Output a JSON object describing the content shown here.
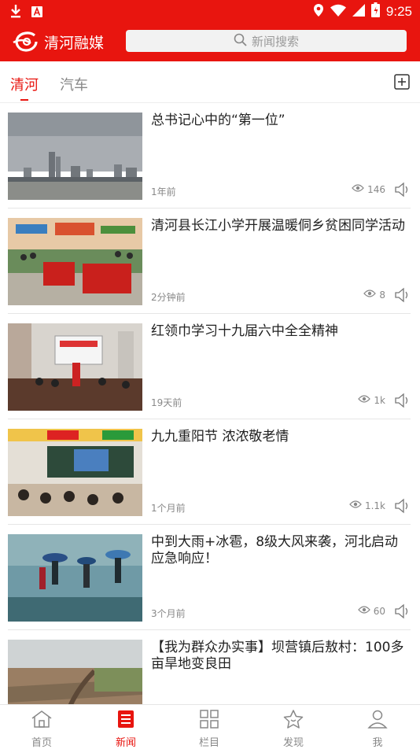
{
  "status_bar": {
    "time": "9:25",
    "icons": [
      "download-icon",
      "a-badge-icon",
      "location-icon",
      "wifi-icon",
      "signal-icon",
      "battery-charging-icon"
    ]
  },
  "app_bar": {
    "title": "清河融媒",
    "search_placeholder": "新闻搜索"
  },
  "tabs": [
    {
      "label": "清河",
      "active": true
    },
    {
      "label": "汽车",
      "active": false
    }
  ],
  "news": [
    {
      "title": "总书记心中的“第一位”",
      "time": "1年前",
      "views": "146"
    },
    {
      "title": "清河县长江小学开展温暖侗乡贫困同学活动",
      "time": "2分钟前",
      "views": "8"
    },
    {
      "title": "红领巾学习十九届六中全全精神",
      "time": "19天前",
      "views": "1k"
    },
    {
      "title": "九九重阳节 浓浓敬老情",
      "time": "1个月前",
      "views": "1.1k"
    },
    {
      "title": "中到大雨+冰雹，8级大风来袭，河北启动应急响应！",
      "time": "3个月前",
      "views": "60"
    },
    {
      "title": "【我为群众办实事】坝营镇后敖村：100多亩旱地变良田",
      "time": "",
      "views": ""
    }
  ],
  "bottom_nav": [
    {
      "label": "首页",
      "icon": "home-icon",
      "active": false
    },
    {
      "label": "新闻",
      "icon": "news-icon",
      "active": true
    },
    {
      "label": "栏目",
      "icon": "grid-icon",
      "active": false
    },
    {
      "label": "发现",
      "icon": "star-icon",
      "active": false
    },
    {
      "label": "我",
      "icon": "profile-icon",
      "active": false
    }
  ],
  "colors": {
    "brand": "#e8150f",
    "text": "#222222",
    "muted": "#888888"
  }
}
